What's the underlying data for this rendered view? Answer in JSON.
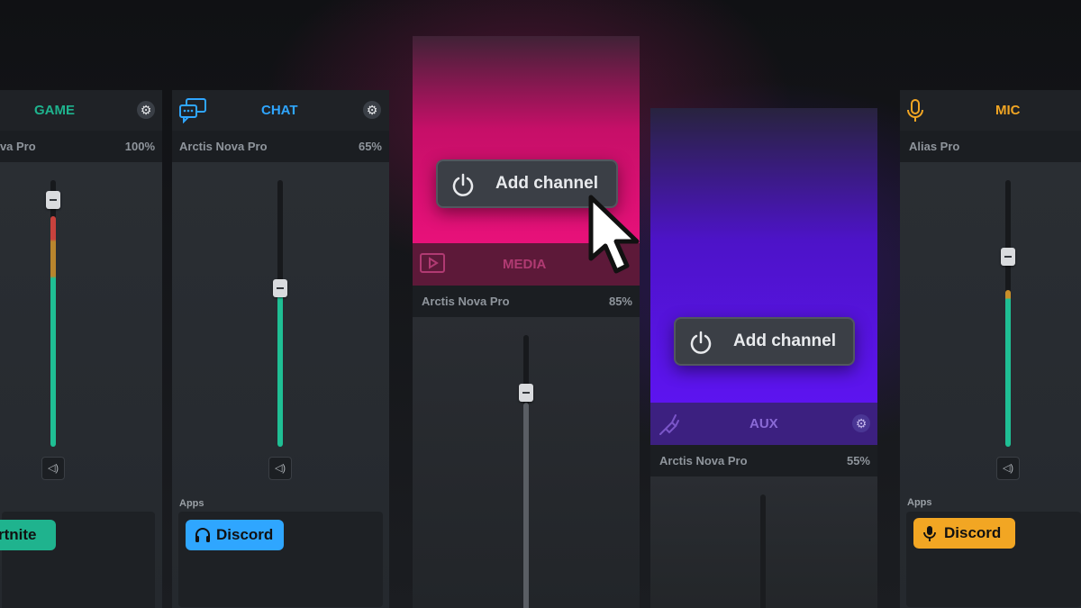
{
  "colors": {
    "game": "#1fb38e",
    "chat": "#2fa6ff",
    "media_pink": "#e8117a",
    "aux_purple": "#5d14f0",
    "mic": "#f2a623",
    "level_green": "#1fbf94"
  },
  "channels": {
    "game": {
      "title": "GAME",
      "device": "ova Pro",
      "percent": "100%",
      "level": 0.86,
      "app": "rtnite",
      "icon": "gear-icon"
    },
    "chat": {
      "title": "CHAT",
      "device": "Arctis Nova Pro",
      "percent": "65%",
      "level": 0.6,
      "apps_label": "Apps",
      "app": "Discord",
      "icon": "chat-bubbles-icon"
    },
    "media": {
      "title": "MEDIA",
      "device": "Arctis Nova Pro",
      "percent": "85%",
      "add_label": "Add channel",
      "icon": "play-box-icon"
    },
    "aux": {
      "title": "AUX",
      "device": "Arctis Nova Pro",
      "percent": "55%",
      "add_label": "Add channel",
      "icon": "cable-icon"
    },
    "mic": {
      "title": "MIC",
      "device": "Alias Pro",
      "apps_label": "Apps",
      "app": "Discord",
      "level": 0.58,
      "icon": "microphone-icon"
    }
  }
}
